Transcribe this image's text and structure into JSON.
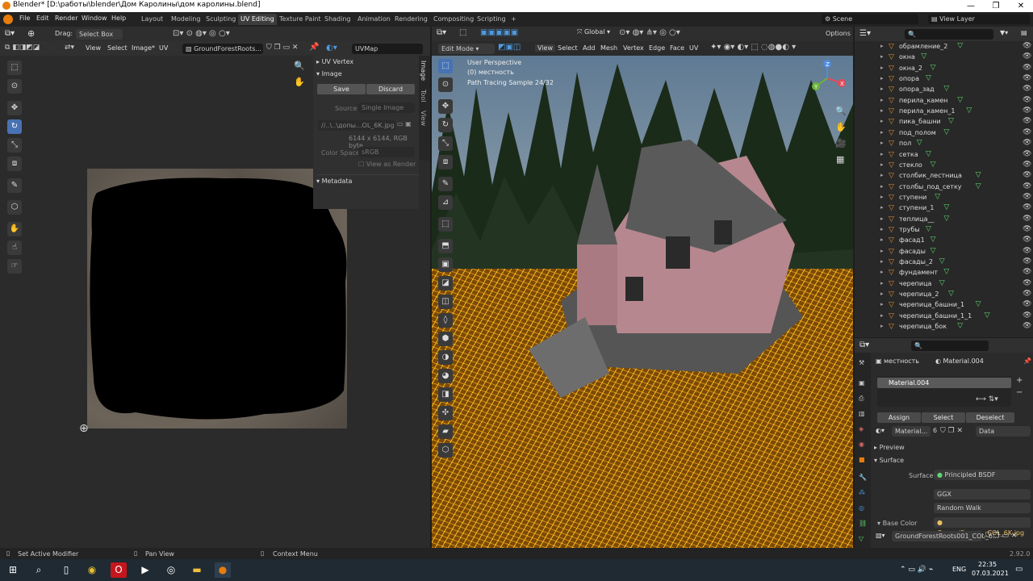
{
  "app": {
    "title": "Blender* [D:\\работы\\blender\\Дом Каролины\\дом каролины.blend]",
    "win_min": "—",
    "win_max": "❐",
    "win_close": "✕"
  },
  "menu": [
    "File",
    "Edit",
    "Render",
    "Window",
    "Help"
  ],
  "workspaces": [
    "Layout",
    "Modeling",
    "Sculpting",
    "UV Editing",
    "Texture Paint",
    "Shading",
    "Animation",
    "Rendering",
    "Compositing",
    "Scripting"
  ],
  "active_workspace": "UV Editing",
  "add_workspace": "+",
  "scene": {
    "name": "Scene",
    "view_layer": "View Layer"
  },
  "uv_editor": {
    "drag_label": "Drag:",
    "select_mode": "Select Box",
    "menus": [
      "View",
      "Select",
      "Image*",
      "UV"
    ],
    "image_name": "GroundForestRoots...",
    "uvmap": "UVMap",
    "panel": {
      "uv_vertex": "UV Vertex",
      "image": "Image",
      "save": "Save",
      "discard": "Discard",
      "source_label": "Source",
      "source": "Single Image",
      "path": "//..\\..\\допы...OL_6K.jpg",
      "info": "6144 x 6144, RGB byte",
      "color_space_label": "Color Space",
      "color_space": "sRGB",
      "view_as_render": "View as Render",
      "metadata": "Metadata"
    },
    "side_tabs": [
      "Image",
      "Tool",
      "View"
    ]
  },
  "viewport": {
    "mode": "Edit Mode",
    "menus": [
      "View",
      "Select",
      "Add",
      "Mesh",
      "Vertex",
      "Edge",
      "Face",
      "UV"
    ],
    "orientation": "Global",
    "options": "Options",
    "overlay_text": [
      "User Perspective",
      "(0) местность",
      "Path Tracing Sample 24/32"
    ],
    "gizmo": {
      "x": "X",
      "y": "Y",
      "z": "Z"
    }
  },
  "outliner": {
    "search_placeholder": "",
    "items": [
      {
        "name": "обрамление_2"
      },
      {
        "name": "окна"
      },
      {
        "name": "окна_2"
      },
      {
        "name": "опора"
      },
      {
        "name": "опора_зад"
      },
      {
        "name": "перила_камен"
      },
      {
        "name": "перила_камен_1"
      },
      {
        "name": "пика_башни"
      },
      {
        "name": "под_полом"
      },
      {
        "name": "пол"
      },
      {
        "name": "сетка"
      },
      {
        "name": "стекло"
      },
      {
        "name": "столбик_лестница"
      },
      {
        "name": "столбы_под_сетку"
      },
      {
        "name": "ступени"
      },
      {
        "name": "ступени_1"
      },
      {
        "name": "теплица__"
      },
      {
        "name": "трубы"
      },
      {
        "name": "фасад1"
      },
      {
        "name": "фасады"
      },
      {
        "name": "фасады_2"
      },
      {
        "name": "фундамент"
      },
      {
        "name": "черепица"
      },
      {
        "name": "черепица_2"
      },
      {
        "name": "черепица_башни_1"
      },
      {
        "name": "черепица_башни_1_1"
      },
      {
        "name": "черепица_бок"
      }
    ]
  },
  "properties": {
    "object": "местность",
    "material": "Material.004",
    "slot": "Material.004",
    "assign": "Assign",
    "select": "Select",
    "deselect": "Deselect",
    "mat_field": "Material...",
    "users": "6",
    "link": "Data",
    "preview": "Preview",
    "surface_header": "Surface",
    "surface_label": "Surface",
    "surface": "Principled BSDF",
    "distribution": "GGX",
    "subsurface": "Random Walk",
    "base_color_label": "Base Color",
    "base_color": "GroundFores..._COL_6K.jpg",
    "texture": "GroundForestRoots001_COL_6..."
  },
  "status": {
    "left": "Set Active Modifier",
    "mid": "Pan View",
    "right": "Context Menu",
    "version": "2.92.0"
  },
  "taskbar": {
    "lang": "ENG",
    "time": "22:35",
    "date": "07.03.2021"
  },
  "colors": {
    "accent": "#4772b3",
    "orange": "#e87d0d",
    "wire": "#f0a010"
  }
}
